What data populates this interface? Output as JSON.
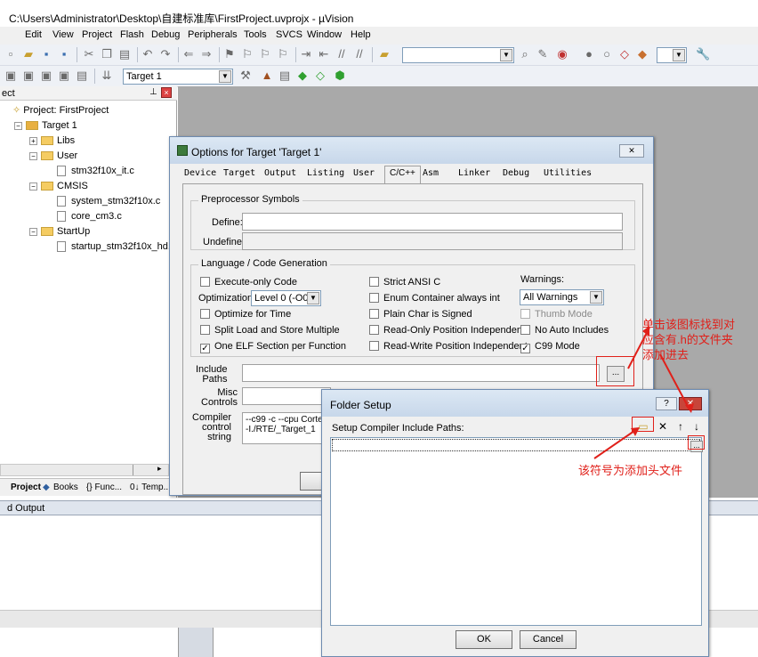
{
  "window": {
    "title": "C:\\Users\\Administrator\\Desktop\\自建标准库\\FirstProject.uvprojx - µVision"
  },
  "menu": [
    "Edit",
    "View",
    "Project",
    "Flash",
    "Debug",
    "Peripherals",
    "Tools",
    "SVCS",
    "Window",
    "Help"
  ],
  "toolbar": {
    "target_combo": "Target 1"
  },
  "project_panel": {
    "header": "ect",
    "root": "Project: FirstProject",
    "target": "Target 1",
    "groups": [
      {
        "name": "Libs",
        "files": []
      },
      {
        "name": "User",
        "files": [
          "stm32f10x_it.c"
        ]
      },
      {
        "name": "CMSIS",
        "files": [
          "system_stm32f10x.c",
          "core_cm3.c"
        ]
      },
      {
        "name": "StartUp",
        "files": [
          "startup_stm32f10x_hd.s"
        ]
      }
    ],
    "tabs": [
      "Project",
      "Books",
      "{} Func...",
      "0↓ Temp..."
    ]
  },
  "build_output": {
    "title": "d Output"
  },
  "options_dialog": {
    "title": "Options for Target 'Target 1'",
    "tabs": [
      "Device",
      "Target",
      "Output",
      "Listing",
      "User",
      "C/C++",
      "Asm",
      "Linker",
      "Debug",
      "Utilities"
    ],
    "active_tab": "C/C++",
    "preprocessor": {
      "group": "Preprocessor Symbols",
      "define_label": "Define:",
      "define_value": "",
      "undefine_label": "Undefine:"
    },
    "language": {
      "group": "Language / Code Generation",
      "execute_only": "Execute-only Code",
      "optimization_label": "Optimization:",
      "optimization_value": "Level 0 (-O0)",
      "optimize_time": "Optimize for Time",
      "split_load": "Split Load and Store Multiple",
      "one_elf": "One ELF Section per Function",
      "strict_ansi": "Strict ANSI C",
      "enum_int": "Enum Container always int",
      "plain_char": "Plain Char is Signed",
      "ropi": "Read-Only Position Independent",
      "rwpi": "Read-Write Position Independent",
      "warnings_label": "Warnings:",
      "warnings_value": "All Warnings",
      "thumb_mode": "Thumb Mode",
      "no_auto_includes": "No Auto Includes",
      "c99_mode": "C99 Mode",
      "checked": {
        "one_elf": true,
        "c99_mode": true
      }
    },
    "include_paths_label": "Include\nPaths",
    "misc_controls_label": "Misc\nControls",
    "compiler_string_label": "Compiler\ncontrol\nstring",
    "compiler_string_value": "--c99 -c --cpu Cortex-M\n-I./RTE/_Target_1"
  },
  "folder_setup": {
    "title": "Folder Setup",
    "help_button": "?",
    "label": "Setup Compiler Include Paths:",
    "ok_label": "OK",
    "cancel_label": "Cancel"
  },
  "annotations": {
    "include_icon_note": "单击该图标找到对\n应含有.h的文件夹\n添加进去",
    "new_folder_note": "该符号为添加头文件"
  },
  "colors": {
    "annotation_red": "#e0201a",
    "accent_blue": "#6e8bb0"
  }
}
